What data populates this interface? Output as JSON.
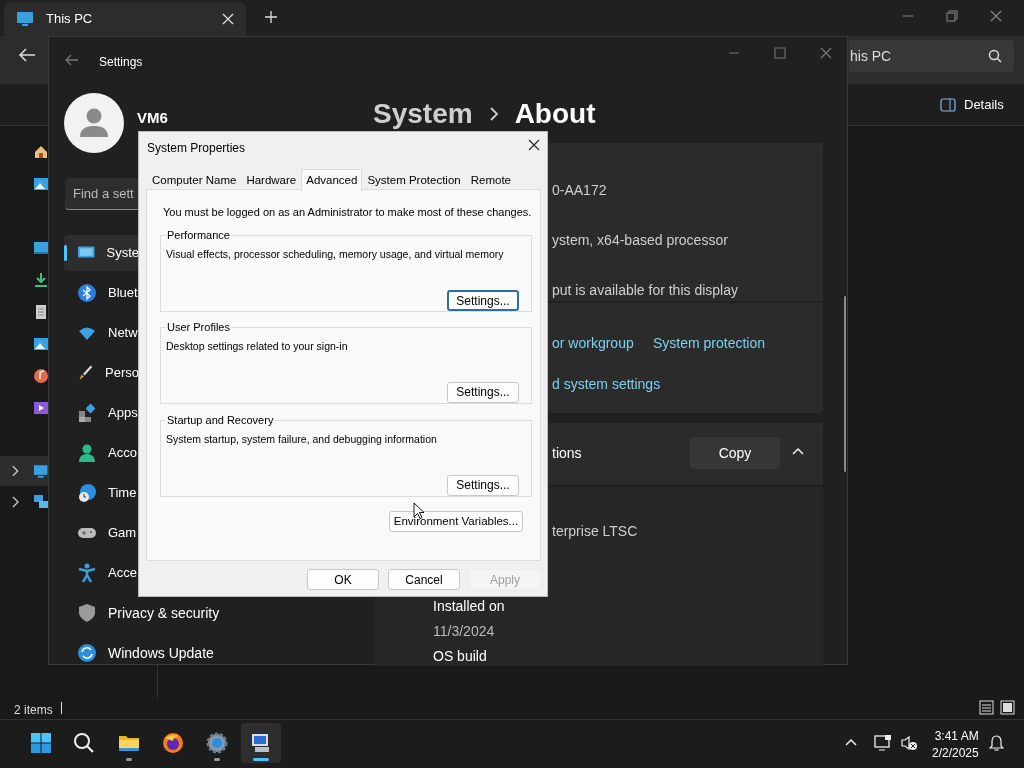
{
  "explorer": {
    "tab_title": "This PC",
    "search_value": "his PC",
    "details_label": "Details",
    "status": "2 items"
  },
  "settings": {
    "title": "Settings",
    "user": "VM6",
    "search_placeholder": "Find a sett",
    "nav": [
      {
        "label": "Syste",
        "selected": true
      },
      {
        "label": "Bluet",
        "selected": false
      },
      {
        "label": "Netw",
        "selected": false
      },
      {
        "label": "Perso",
        "selected": false
      },
      {
        "label": "Apps",
        "selected": false
      },
      {
        "label": "Acco",
        "selected": false
      },
      {
        "label": "Time",
        "selected": false
      },
      {
        "label": "Gam",
        "selected": false
      },
      {
        "label": "Acce",
        "selected": false
      },
      {
        "label": "Privacy & security",
        "selected": false
      },
      {
        "label": "Windows Update",
        "selected": false
      }
    ],
    "breadcrumb_parent": "System",
    "breadcrumb_current": "About",
    "spec_values": [
      "0-AA172",
      "ystem, x64-based processor",
      "put is available for this display"
    ],
    "links": [
      "or workgroup",
      "System protection"
    ],
    "advanced_link": "d system settings",
    "windows_spec": {
      "title": "tions",
      "copy": "Copy",
      "expanded": true
    },
    "edition": "terprise LTSC",
    "install_label": "Installed on",
    "install_value": "11/3/2024",
    "build_label": "OS build"
  },
  "dialog": {
    "title": "System Properties",
    "tabs": [
      {
        "label": "Computer Name",
        "selected": false
      },
      {
        "label": "Hardware",
        "selected": false
      },
      {
        "label": "Advanced",
        "selected": true
      },
      {
        "label": "System Protection",
        "selected": false
      },
      {
        "label": "Remote",
        "selected": false
      }
    ],
    "notice": "You must be logged on as an Administrator to make most of these changes.",
    "groups": [
      {
        "title": "Performance",
        "description": "Visual effects, processor scheduling, memory usage, and virtual memory",
        "button": "Settings...",
        "focused": true
      },
      {
        "title": "User Profiles",
        "description": "Desktop settings related to your sign-in",
        "button": "Settings...",
        "focused": false
      },
      {
        "title": "Startup and Recovery",
        "description": "System startup, system failure, and debugging information",
        "button": "Settings...",
        "focused": false
      }
    ],
    "env_button": "Environment Variables...",
    "buttons": [
      {
        "label": "OK",
        "disabled": false
      },
      {
        "label": "Cancel",
        "disabled": false
      },
      {
        "label": "Apply",
        "disabled": true
      }
    ]
  },
  "taskbar": {
    "apps": [
      {
        "kind": "start",
        "running": false,
        "selected": false
      },
      {
        "kind": "search",
        "running": false,
        "selected": false
      },
      {
        "kind": "explorer",
        "running": true,
        "selected": false
      },
      {
        "kind": "firefox",
        "running": false,
        "selected": false
      },
      {
        "kind": "settings",
        "running": true,
        "selected": false
      },
      {
        "kind": "system",
        "running": true,
        "selected": true
      }
    ],
    "time": "3:41 AM",
    "date": "2/2/2025"
  }
}
